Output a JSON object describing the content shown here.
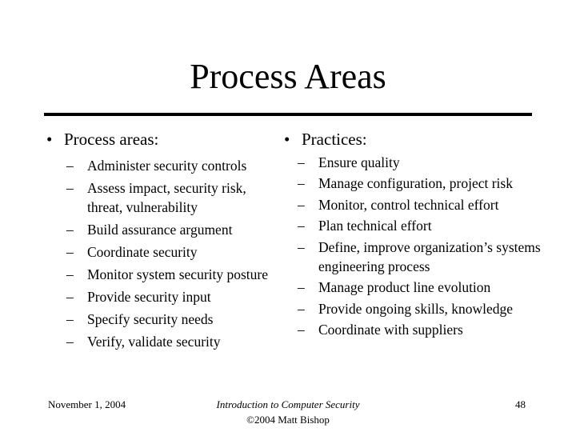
{
  "slide": {
    "title": "Process Areas",
    "left": {
      "heading": "Process areas:",
      "bullet_symbol": "•",
      "dash_symbol": "–",
      "items": [
        "Administer security controls",
        "Assess impact, security risk, threat, vulnerability",
        "Build assurance argument",
        "Coordinate security",
        "Monitor system security posture",
        "Provide security input",
        "Specify security needs",
        "Verify, validate security"
      ]
    },
    "right": {
      "heading": "Practices:",
      "bullet_symbol": "•",
      "dash_symbol": "–",
      "items": [
        "Ensure quality",
        "Manage configuration,  project risk",
        "Monitor, control technical effort",
        "Plan technical effort",
        "Define, improve organization’s systems engineering process",
        "Manage product line evolution",
        "Provide ongoing skills, knowledge",
        "Coordinate with suppliers"
      ]
    },
    "footer": {
      "date": "November 1, 2004",
      "course": "Introduction to Computer Security",
      "copyright": "©2004 Matt Bishop",
      "page": "48"
    }
  }
}
